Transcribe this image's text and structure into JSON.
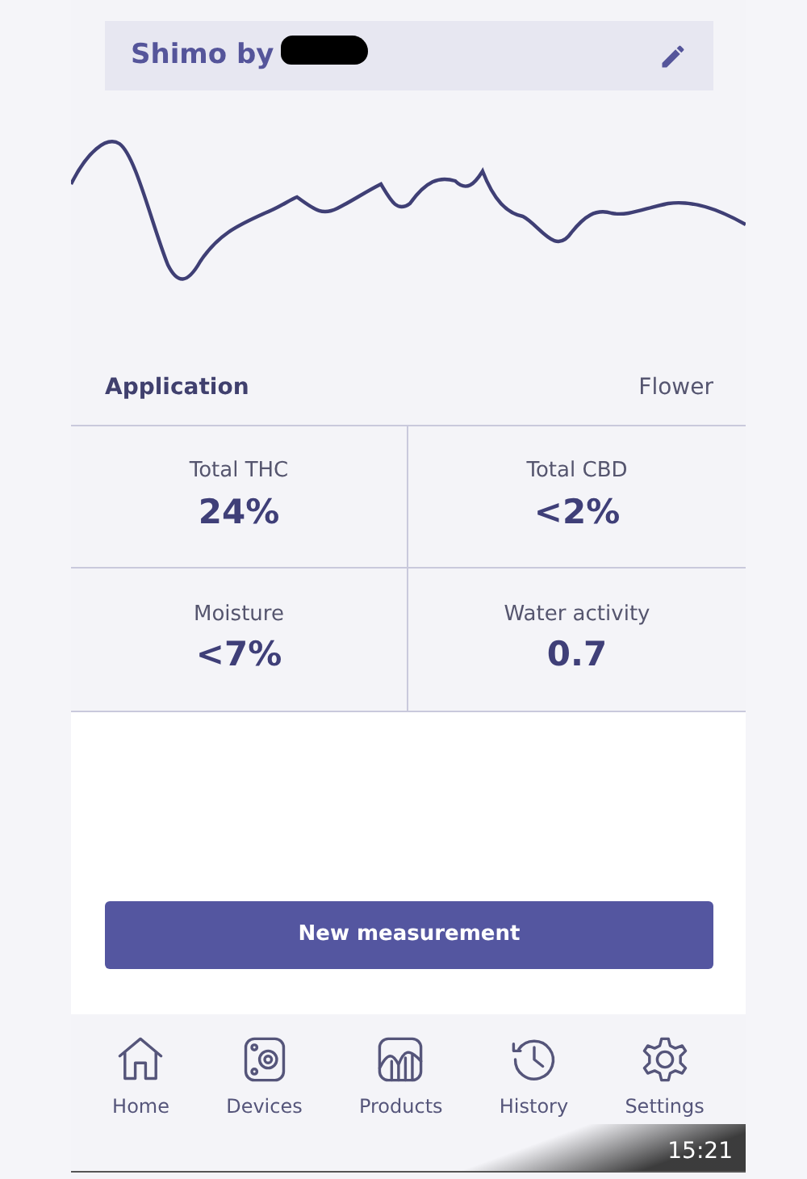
{
  "header": {
    "title": "Shimo by",
    "redacted": true
  },
  "application": {
    "label": "Application",
    "value": "Flower"
  },
  "metrics": [
    {
      "label": "Total THC",
      "value": "24%"
    },
    {
      "label": "Total CBD",
      "value": "<2%"
    },
    {
      "label": "Moisture",
      "value": "<7%"
    },
    {
      "label": "Water activity",
      "value": "0.7"
    }
  ],
  "action_button": "New measurement",
  "nav": [
    {
      "label": "Home",
      "kind": "home",
      "selected": false
    },
    {
      "label": "Devices",
      "kind": "device",
      "selected": false
    },
    {
      "label": "Products",
      "kind": "chart",
      "selected": false
    },
    {
      "label": "History",
      "kind": "history",
      "selected": false
    },
    {
      "label": "Settings",
      "kind": "gear",
      "selected": false
    }
  ],
  "overlay": {
    "time": "15:21"
  }
}
